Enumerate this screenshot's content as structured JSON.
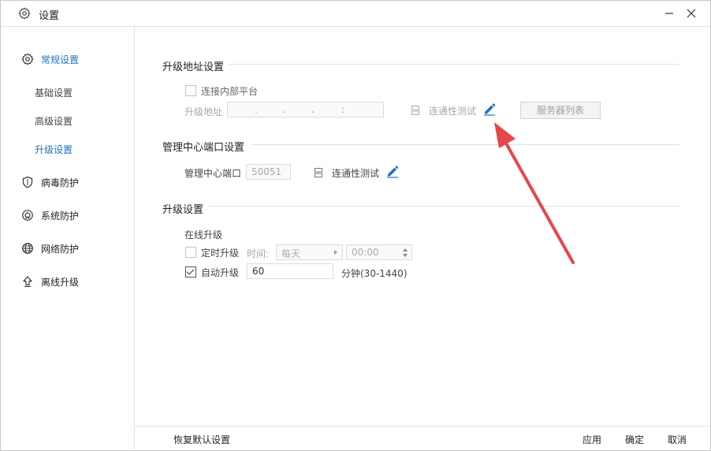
{
  "window": {
    "title": "设置",
    "icons": {
      "title": "gear-icon",
      "minimize": "minimize-icon",
      "close": "close-icon"
    }
  },
  "sidebar": {
    "items": [
      {
        "label": "常规设置",
        "icon": "gear-icon",
        "active": true
      },
      {
        "label": "病毒防护",
        "icon": "shield-icon"
      },
      {
        "label": "系统防护",
        "icon": "system-shield-icon"
      },
      {
        "label": "网络防护",
        "icon": "globe-icon"
      },
      {
        "label": "离线升级",
        "icon": "upload-arrow-icon"
      }
    ],
    "sub_items": [
      {
        "label": "基础设置"
      },
      {
        "label": "高级设置"
      },
      {
        "label": "升级设置",
        "active": true
      }
    ]
  },
  "upgrade_address": {
    "title": "升级地址设置",
    "connect_internal_label": "连接内部平台",
    "connect_internal_checked": false,
    "address_label": "升级地址",
    "ip_separators": [
      ".",
      ".",
      ".",
      ":"
    ],
    "connectivity_test_label": "连通性测试",
    "server_list_button": "服务器列表"
  },
  "management_port": {
    "title": "管理中心端口设置",
    "port_label": "管理中心端口",
    "port_value": "50051",
    "connectivity_test_label": "连通性测试"
  },
  "upgrade_settings": {
    "title": "升级设置",
    "online_upgrade_label": "在线升级",
    "scheduled_label": "定时升级",
    "scheduled_checked": false,
    "time_label": "时间:",
    "frequency_value": "每天",
    "time_value": "00:00",
    "auto_label": "自动升级",
    "auto_checked": true,
    "auto_value": "60",
    "auto_unit": "分钟(30-1440)"
  },
  "footer": {
    "restore_defaults": "恢复默认设置",
    "apply": "应用",
    "ok": "确定",
    "cancel": "取消"
  },
  "colors": {
    "accent": "#1a73c7",
    "annotation_arrow": "#e8474a"
  }
}
